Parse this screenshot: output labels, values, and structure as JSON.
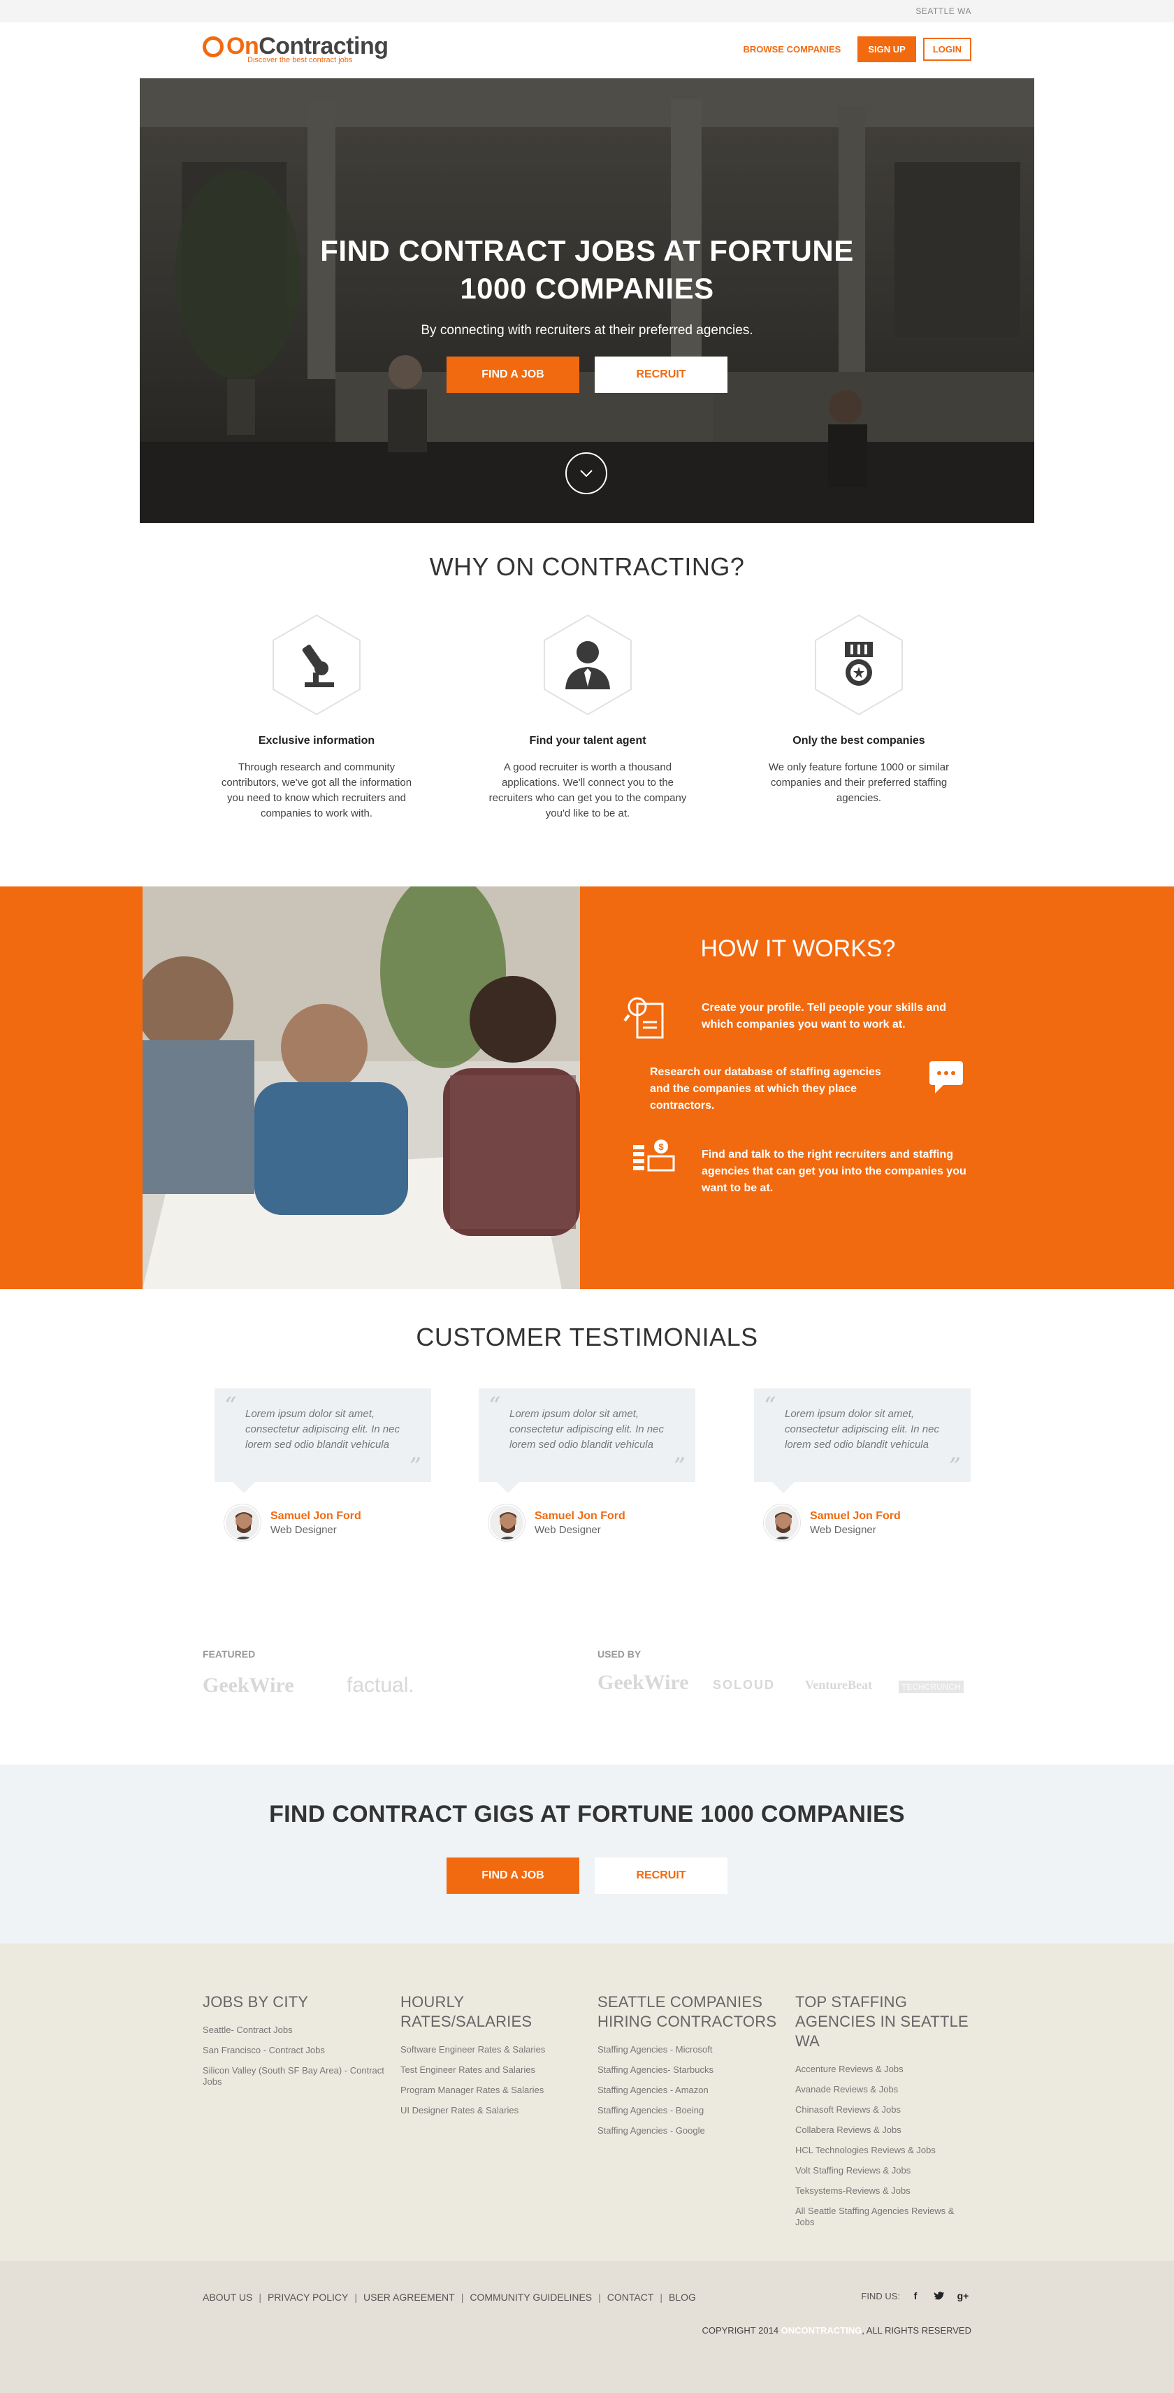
{
  "topbar": {
    "city": "SEATTLE WA"
  },
  "header": {
    "logo_on": "On",
    "logo_rest": "Contracting",
    "tagline": "Discover the best contract jobs",
    "browse": "BROWSE COMPANIES",
    "signup": "SIGN UP",
    "login": "LOGIN"
  },
  "hero": {
    "title": "FIND CONTRACT JOBS AT FORTUNE 1000 COMPANIES",
    "subtitle": "By connecting with recruiters at their preferred agencies.",
    "find_job": "FIND A JOB",
    "recruit": "RECRUIT"
  },
  "why": {
    "title": "WHY ON CONTRACTING?",
    "items": [
      {
        "icon": "microscope-icon",
        "title": "Exclusive information",
        "desc": "Through research and community contributors, we've got all the information you need to know which recruiters and companies to work with."
      },
      {
        "icon": "agent-icon",
        "title": "Find your talent agent",
        "desc": "A good recruiter is worth a thousand applications. We'll connect you to the recruiters who can get you to the company you'd like to be at."
      },
      {
        "icon": "medal-icon",
        "title": "Only the best companies",
        "desc": "We only feature fortune 1000 or similar companies and their preferred staffing agencies."
      }
    ]
  },
  "how": {
    "title": "HOW IT WORKS?",
    "steps": [
      "Create your profile. Tell people your skills and which companies you want to work at.",
      "Research our database of staffing agencies and the companies at which they place contractors.",
      "Find and talk to the right recruiters and staffing agencies that can get you into the companies you want to be at."
    ]
  },
  "testimonials": {
    "title": "CUSTOMER TESTIMONIALS",
    "items": [
      {
        "quote": "Lorem ipsum dolor sit amet, consectetur adipiscing elit. In nec lorem sed odio blandit vehicula",
        "name": "Samuel Jon Ford",
        "role": "Web Designer"
      },
      {
        "quote": "Lorem ipsum dolor sit amet, consectetur adipiscing elit. In nec lorem sed odio blandit vehicula",
        "name": "Samuel Jon Ford",
        "role": "Web Designer"
      },
      {
        "quote": "Lorem ipsum dolor sit amet, consectetur adipiscing elit. In nec lorem sed odio blandit vehicula",
        "name": "Samuel Jon Ford",
        "role": "Web Designer"
      }
    ]
  },
  "press": {
    "featured_title": "FEATURED",
    "featured": [
      "GeekWire",
      "factual."
    ],
    "used_title": "USED BY",
    "used": [
      "GeekWire",
      "SOLOUD",
      "VentureBeat",
      "TECHCRUNCH"
    ]
  },
  "cta": {
    "title": "FIND CONTRACT GIGS AT FORTUNE 1000 COMPANIES",
    "find_job": "FIND A JOB",
    "recruit": "RECRUIT"
  },
  "footer": {
    "col1": {
      "title": "JOBS BY CITY",
      "links": [
        "Seattle- Contract Jobs",
        "San Francisco - Contract Jobs",
        "Silicon Valley (South SF Bay Area) - Contract Jobs"
      ]
    },
    "col2": {
      "title": "HOURLY RATES/SALARIES",
      "links": [
        "Software Engineer Rates & Salaries",
        "Test Engineer Rates and Salaries",
        "Program Manager Rates & Salaries",
        "UI Designer Rates & Salaries"
      ]
    },
    "col3": {
      "title": "SEATTLE COMPANIES HIRING CONTRACTORS",
      "links": [
        "Staffing Agencies - Microsoft",
        "Staffing Agencies- Starbucks",
        "Staffing Agencies - Amazon",
        "Staffing Agencies - Boeing",
        "Staffing Agencies - Google"
      ]
    },
    "col4": {
      "title": "TOP STAFFING AGENCIES IN SEATTLE WA",
      "links": [
        "Accenture Reviews & Jobs",
        "Avanade Reviews & Jobs",
        "Chinasoft Reviews & Jobs",
        "Collabera Reviews & Jobs",
        "HCL Technologies Reviews & Jobs",
        "Volt Staffing Reviews & Jobs",
        "Teksystems-Reviews & Jobs",
        "All Seattle Staffing Agencies Reviews & Jobs"
      ]
    }
  },
  "bottom": {
    "links": [
      "ABOUT US",
      "PRIVACY POLICY",
      "USER AGREEMENT",
      "COMMUNITY GUIDELINES",
      "CONTACT",
      "BLOG"
    ],
    "find_us": "FIND US:",
    "social": [
      "f",
      "t",
      "g+"
    ],
    "copyright_pre": "COPYRIGHT 2014 ",
    "copyright_brand": "ONCONTRACTING",
    "copyright_post": ", ALL RIGHTS RESERVED"
  },
  "colors": {
    "accent": "#f26a10",
    "cta_bg": "#eff3f6",
    "footer_bg": "#ece9df"
  }
}
